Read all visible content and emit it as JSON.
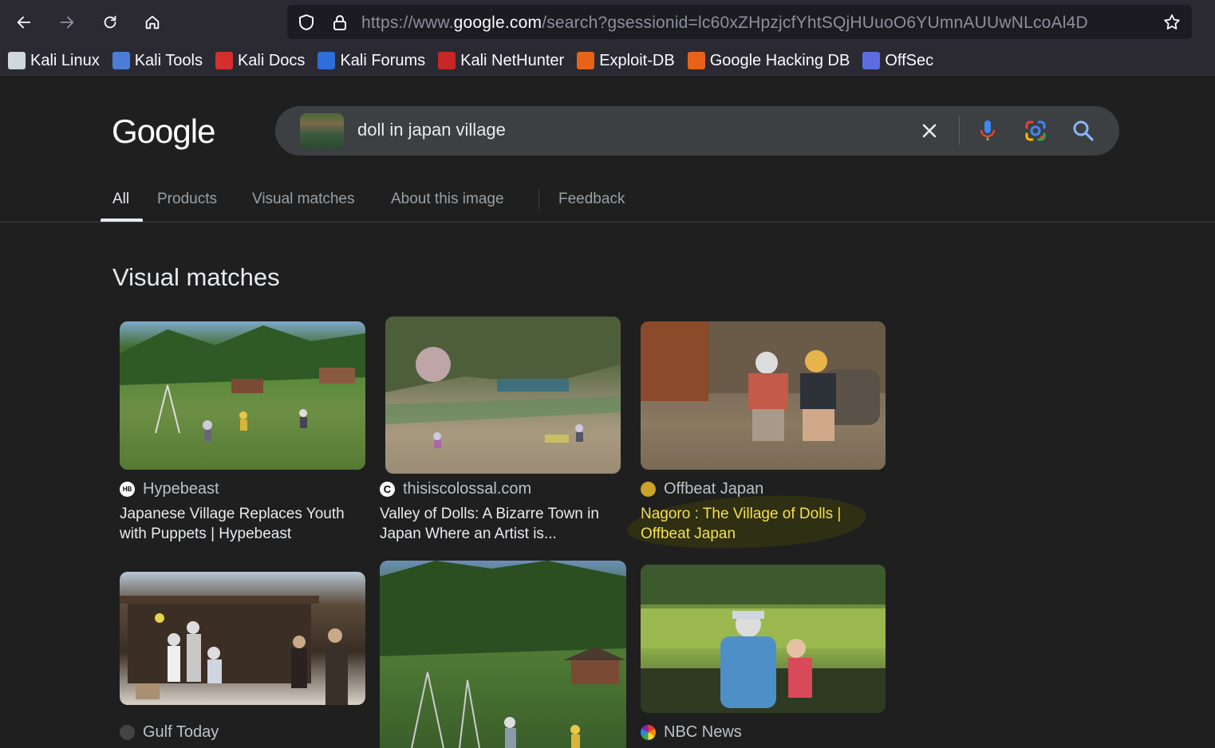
{
  "browser": {
    "url_prefix": "https://www.",
    "url_domain": "google.com",
    "url_rest": "/search?gsessionid=lc60xZHpzjcfYhtSQjHUuoO6YUmnAUUwNLcoAl4D",
    "bookmarks": [
      {
        "label": "Kali Linux",
        "icon": "kali-dragon-icon",
        "color": "#cfd8dc"
      },
      {
        "label": "Kali Tools",
        "icon": "kali-tools-icon",
        "color": "#4a7dd6"
      },
      {
        "label": "Kali Docs",
        "icon": "kali-docs-icon",
        "color": "#d32f2f"
      },
      {
        "label": "Kali Forums",
        "icon": "kali-forums-icon",
        "color": "#2f6ed8"
      },
      {
        "label": "Kali NetHunter",
        "icon": "nethunter-icon",
        "color": "#c62828"
      },
      {
        "label": "Exploit-DB",
        "icon": "exploit-db-icon",
        "color": "#e8631a"
      },
      {
        "label": "Google Hacking DB",
        "icon": "ghdb-icon",
        "color": "#e8631a"
      },
      {
        "label": "OffSec",
        "icon": "offsec-icon",
        "color": "#5b6ee1"
      }
    ]
  },
  "google": {
    "logo": "Google",
    "query": "doll in japan village",
    "tabs": [
      "All",
      "Products",
      "Visual matches",
      "About this image",
      "Feedback"
    ],
    "section_title": "Visual matches",
    "results": [
      {
        "source": "Hypebeast",
        "fav_color": "#ffffff",
        "fav_text": "HB",
        "title": "Japanese Village Replaces Youth with Puppets | Hypebeast",
        "highlighted": false
      },
      {
        "source": "thisiscolossal.com",
        "fav_color": "#ffffff",
        "fav_text": "C",
        "title": "Valley of Dolls: A Bizarre Town in Japan Where an Artist is...",
        "highlighted": false
      },
      {
        "source": "Offbeat Japan",
        "fav_color": "#c9a227",
        "fav_text": "",
        "title": "Nagoro : The Village of Dolls | Offbeat Japan",
        "highlighted": true
      },
      {
        "source": "Gulf Today",
        "fav_color": "#444444",
        "fav_text": "",
        "title": "",
        "highlighted": false
      },
      {
        "source": "",
        "fav_color": "",
        "fav_text": "",
        "title": "",
        "highlighted": false
      },
      {
        "source": "NBC News",
        "fav_color": "#e53935",
        "fav_text": "",
        "title": "",
        "highlighted": false
      }
    ]
  }
}
